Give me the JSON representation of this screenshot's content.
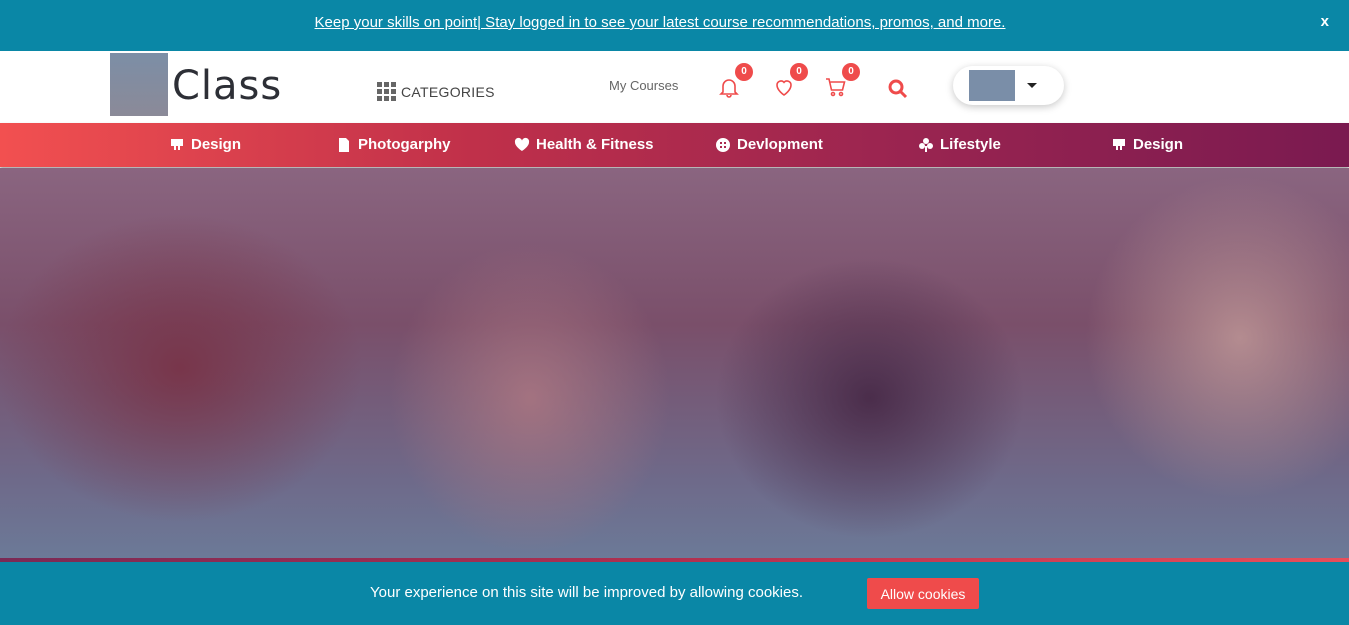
{
  "promo": {
    "text": "Keep your skills on point| Stay logged in to see your latest course recommendations, promos, and more.",
    "close_label": "x"
  },
  "header": {
    "logo_text": "Class",
    "categories_label": "CATEGORIES",
    "my_courses_label": "My Courses",
    "notifications_count": "0",
    "wishlist_count": "0",
    "cart_count": "0"
  },
  "nav": {
    "items": [
      {
        "label": "Design",
        "icon": "design-icon"
      },
      {
        "label": "Photogarphy",
        "icon": "photo-icon"
      },
      {
        "label": "Health & Fitness",
        "icon": "heart-icon"
      },
      {
        "label": "Devlopment",
        "icon": "code-icon"
      },
      {
        "label": "Lifestyle",
        "icon": "flower-icon"
      },
      {
        "label": "Design",
        "icon": "design-icon"
      }
    ]
  },
  "cookie": {
    "text": "Your experience on this site will be improved by allowing cookies.",
    "button_label": "Allow cookies"
  },
  "colors": {
    "teal": "#0a87a6",
    "accent_red": "#ef4b4b",
    "nav_gradient_start": "#f25050",
    "nav_gradient_end": "#7a1a50"
  }
}
